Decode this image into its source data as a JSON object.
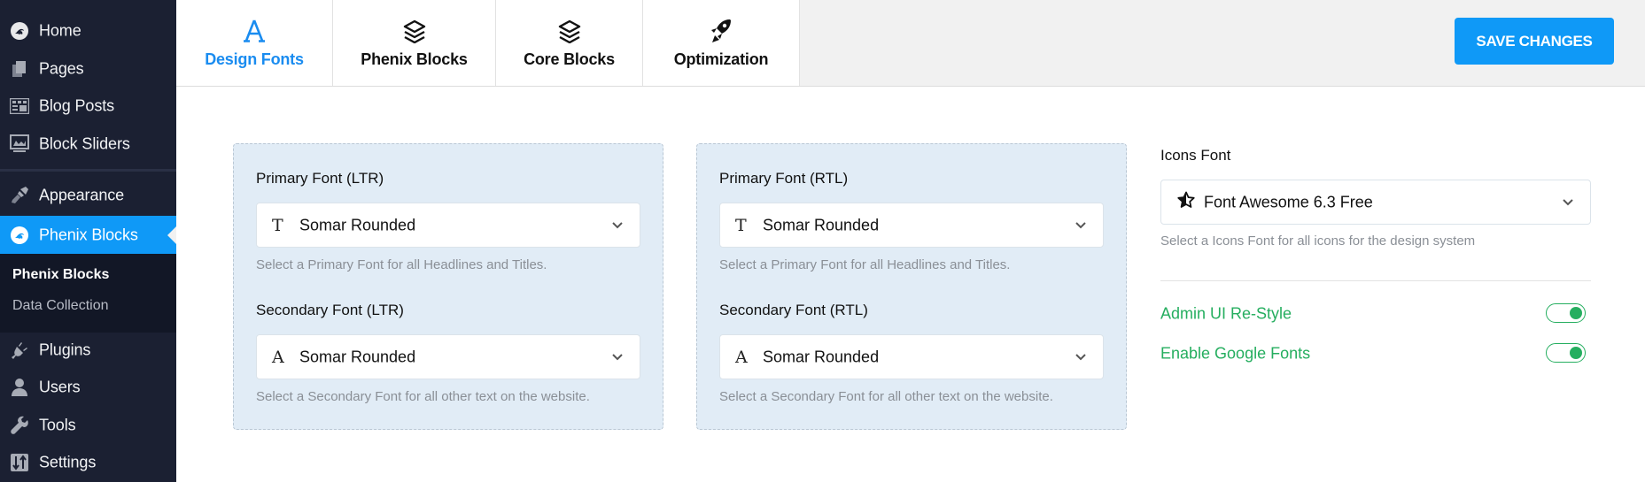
{
  "sidebar": {
    "items": [
      {
        "label": "Home",
        "icon": "phoenix-logo-icon"
      },
      {
        "label": "Pages",
        "icon": "pages-icon"
      },
      {
        "label": "Blog Posts",
        "icon": "blog-posts-icon"
      },
      {
        "label": "Block Sliders",
        "icon": "slider-icon"
      },
      {
        "label": "Appearance",
        "icon": "paintbrush-icon"
      },
      {
        "label": "Phenix Blocks",
        "icon": "phoenix-logo-icon",
        "active": true
      },
      {
        "label": "Plugins",
        "icon": "plug-icon"
      },
      {
        "label": "Users",
        "icon": "user-icon"
      },
      {
        "label": "Tools",
        "icon": "wrench-icon"
      },
      {
        "label": "Settings",
        "icon": "settings-sliders-icon"
      }
    ],
    "submenu": [
      {
        "label": "Phenix Blocks",
        "current": true
      },
      {
        "label": "Data Collection"
      }
    ]
  },
  "header": {
    "tabs": [
      {
        "label": "Design Fonts",
        "icon": "font-a-icon",
        "active": true
      },
      {
        "label": "Phenix Blocks",
        "icon": "layers-icon"
      },
      {
        "label": "Core Blocks",
        "icon": "layers-icon"
      },
      {
        "label": "Optimization",
        "icon": "rocket-icon"
      }
    ],
    "save_label": "SAVE CHANGES"
  },
  "cards": [
    {
      "primary": {
        "label": "Primary Font (LTR)",
        "value": "Somar Rounded",
        "icon_glyph": "T",
        "help": "Select a Primary Font for all Headlines and Titles."
      },
      "secondary": {
        "label": "Secondary Font (LTR)",
        "value": "Somar Rounded",
        "icon_glyph": "A",
        "help": "Select a Secondary Font for all other text on the website."
      }
    },
    {
      "primary": {
        "label": "Primary Font (RTL)",
        "value": "Somar Rounded",
        "icon_glyph": "T",
        "help": "Select a Primary Font for all Headlines and Titles."
      },
      "secondary": {
        "label": "Secondary Font (RTL)",
        "value": "Somar Rounded",
        "icon_glyph": "A",
        "help": "Select a Secondary Font for all other text on the website."
      }
    }
  ],
  "icons_font": {
    "label": "Icons Font",
    "value": "Font Awesome 6.3 Free",
    "help": "Select a Icons Font for all icons for the design system"
  },
  "toggles": [
    {
      "label": "Admin UI Re-Style",
      "on": true
    },
    {
      "label": "Enable Google Fonts",
      "on": true
    }
  ],
  "colors": {
    "accent": "#0f99f7",
    "sidebar_bg": "#1b2032",
    "success_green": "#25ae5f",
    "card_bg": "#e1ecf6"
  }
}
